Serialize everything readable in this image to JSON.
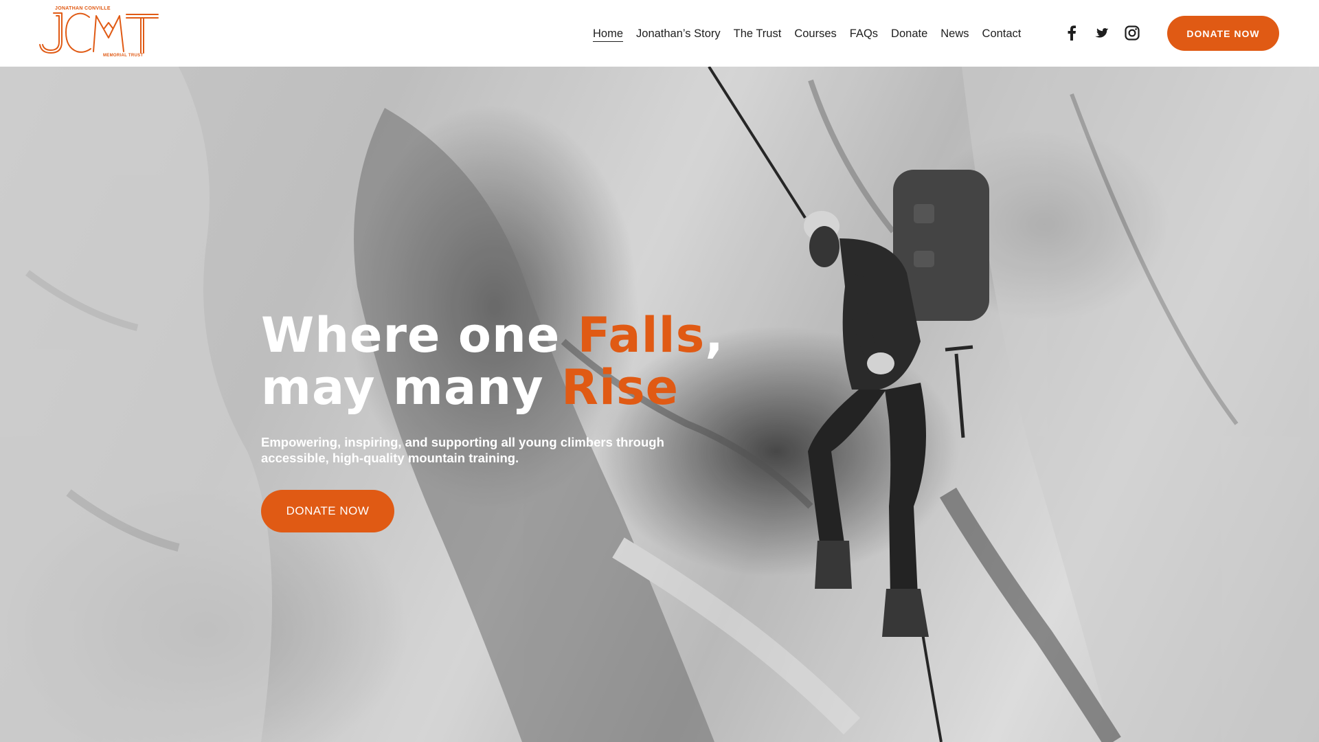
{
  "brand": {
    "logo_letters": "JCMT",
    "logo_top_text": "JONATHAN CONVILLE",
    "logo_bottom_text": "MEMORIAL TRUST",
    "accent_color": "#e05a14"
  },
  "nav": {
    "items": [
      {
        "label": "Home",
        "active": true
      },
      {
        "label": "Jonathan’s Story",
        "active": false
      },
      {
        "label": "The Trust",
        "active": false
      },
      {
        "label": "Courses",
        "active": false
      },
      {
        "label": "FAQs",
        "active": false
      },
      {
        "label": "Donate",
        "active": false
      },
      {
        "label": "News",
        "active": false
      },
      {
        "label": "Contact",
        "active": false
      }
    ]
  },
  "socials": [
    {
      "icon": "facebook-icon"
    },
    {
      "icon": "twitter-icon"
    },
    {
      "icon": "instagram-icon"
    }
  ],
  "header": {
    "cta_label": "DONATE NOW"
  },
  "hero": {
    "headline_line1_prefix": "Where one ",
    "headline_line1_accent": "Falls",
    "headline_line1_suffix": ",",
    "headline_line2_prefix": "may many ",
    "headline_line2_accent": "Rise",
    "subtitle": "Empowering, inspiring, and supporting all young climbers through accessible, high-quality mountain training.",
    "cta_label": "DONATE NOW",
    "background_image": "black-and-white photo of a mountaineer with a large backpack climbing a snowy rock face on a rope"
  }
}
